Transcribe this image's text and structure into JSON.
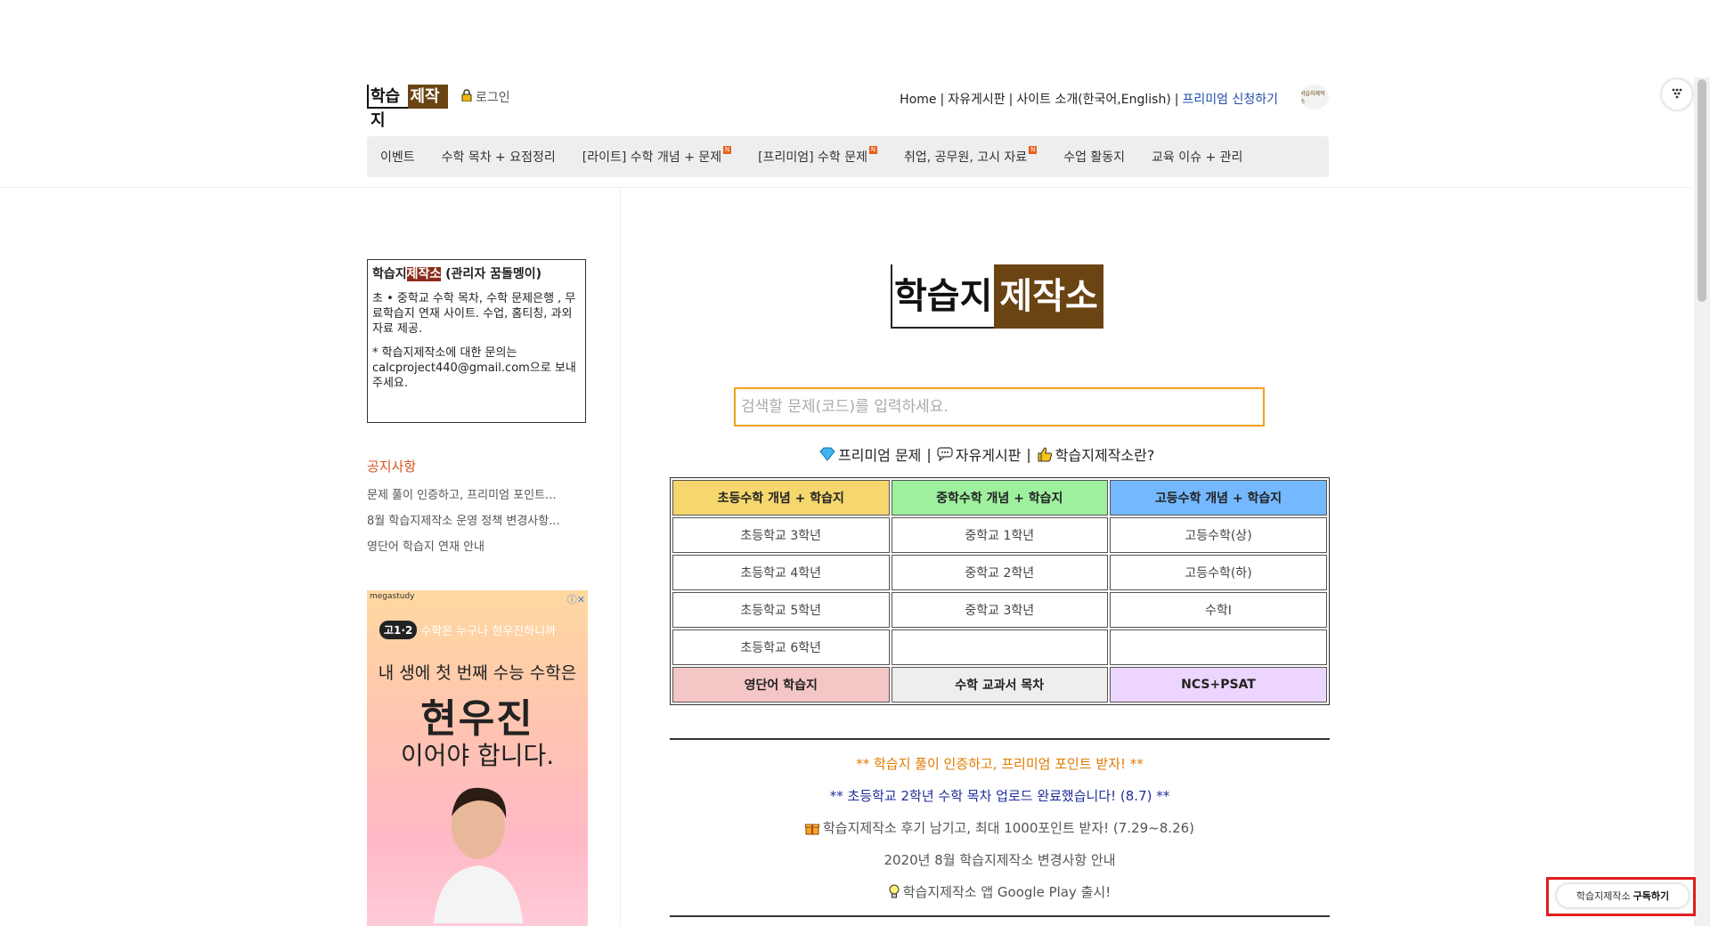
{
  "header": {
    "logo_part1": "학습지",
    "logo_part2": "제작소",
    "login_label": "로그인",
    "top_links": [
      "Home",
      "자유게시판",
      "사이트 소개(한국어,English)"
    ],
    "premium_link": "프리미엄 신청하기",
    "mini_logo": "학습지제작소"
  },
  "menu": [
    {
      "label": "이벤트",
      "new": false
    },
    {
      "label": "수학 목차 + 요점정리",
      "new": false
    },
    {
      "label": "[라이트] 수학 개념 + 문제",
      "new": true
    },
    {
      "label": "[프리미엄] 수학 문제",
      "new": true
    },
    {
      "label": "취업, 공무원, 고시 자료",
      "new": true
    },
    {
      "label": "수업 활동지",
      "new": false
    },
    {
      "label": "교육 이슈 + 관리",
      "new": false
    }
  ],
  "new_badge": "N",
  "sidebar": {
    "intro_title_a": "학습지",
    "intro_title_b": "제작소",
    "intro_title_c": " (관리자 꿈돌멩이)",
    "intro_desc": "초 • 중학교 수학 목차, 수학 문제은행 , 무료학습지 연재 사이트. 수업, 홈티칭, 과외 자료 제공.",
    "intro_contact": "* 학습지제작소에 대한 문의는 calcproject440@gmail.com으로 보내주세요.",
    "notice_title": "공지사항",
    "notices": [
      "문제 풀이 인증하고, 프리미엄 포인트...",
      "8월 학습지제작소 운영 정책 변경사항...",
      "영단어 학습지 연재 안내"
    ]
  },
  "ad": {
    "brand": "megastudy",
    "tag_badge": "고1·2",
    "tag_text": "수학은 누구나 현우진하니까",
    "line1": "내 생에 첫 번째 수능 수학은",
    "line2": "현우진",
    "line3": "이어야 합니다."
  },
  "main": {
    "logo_part1": "학습지",
    "logo_part2": "제작소",
    "search_placeholder": "검색할 문제(코드)를 입력하세요.",
    "quick_links": [
      "프리미엄 문제",
      "자유게시판",
      "학습지제작소란?"
    ],
    "table": {
      "headers": [
        "초등수학 개념 + 학습지",
        "중학수학 개념 + 학습지",
        "고등수학 개념 + 학습지"
      ],
      "rows": [
        [
          "초등학교 3학년",
          "중학교 1학년",
          "고등수학(상)"
        ],
        [
          "초등학교 4학년",
          "중학교 2학년",
          "고등수학(하)"
        ],
        [
          "초등학교 5학년",
          "중학교 3학년",
          "수학Ⅰ"
        ],
        [
          "초등학교 6학년",
          "",
          ""
        ]
      ],
      "footer": [
        "영단어 학습지",
        "수학 교과서 목차",
        "NCS+PSAT"
      ]
    },
    "news": [
      {
        "text": "** 학습지 풀이 인증하고, 프리미엄 포인트 받자! **",
        "color": "#e07b00"
      },
      {
        "text": "** 초등학교 2학년 수학 목차 업로드 완료했습니다! (8.7) **",
        "color": "#1f2f9a"
      },
      {
        "text": "학습지제작소 후기 남기고, 최대 1000포인트 받자! (7.29~8.26)",
        "color": "#555555"
      },
      {
        "text": "2020년 8월 학습지제작소 변경사항 안내",
        "color": "#555555"
      },
      {
        "text": "학습지제작소 앱 Google Play 출시!",
        "color": "#555555"
      }
    ]
  },
  "subscribe": {
    "label_a": "학습지제작소",
    "label_b": "구독하기"
  }
}
